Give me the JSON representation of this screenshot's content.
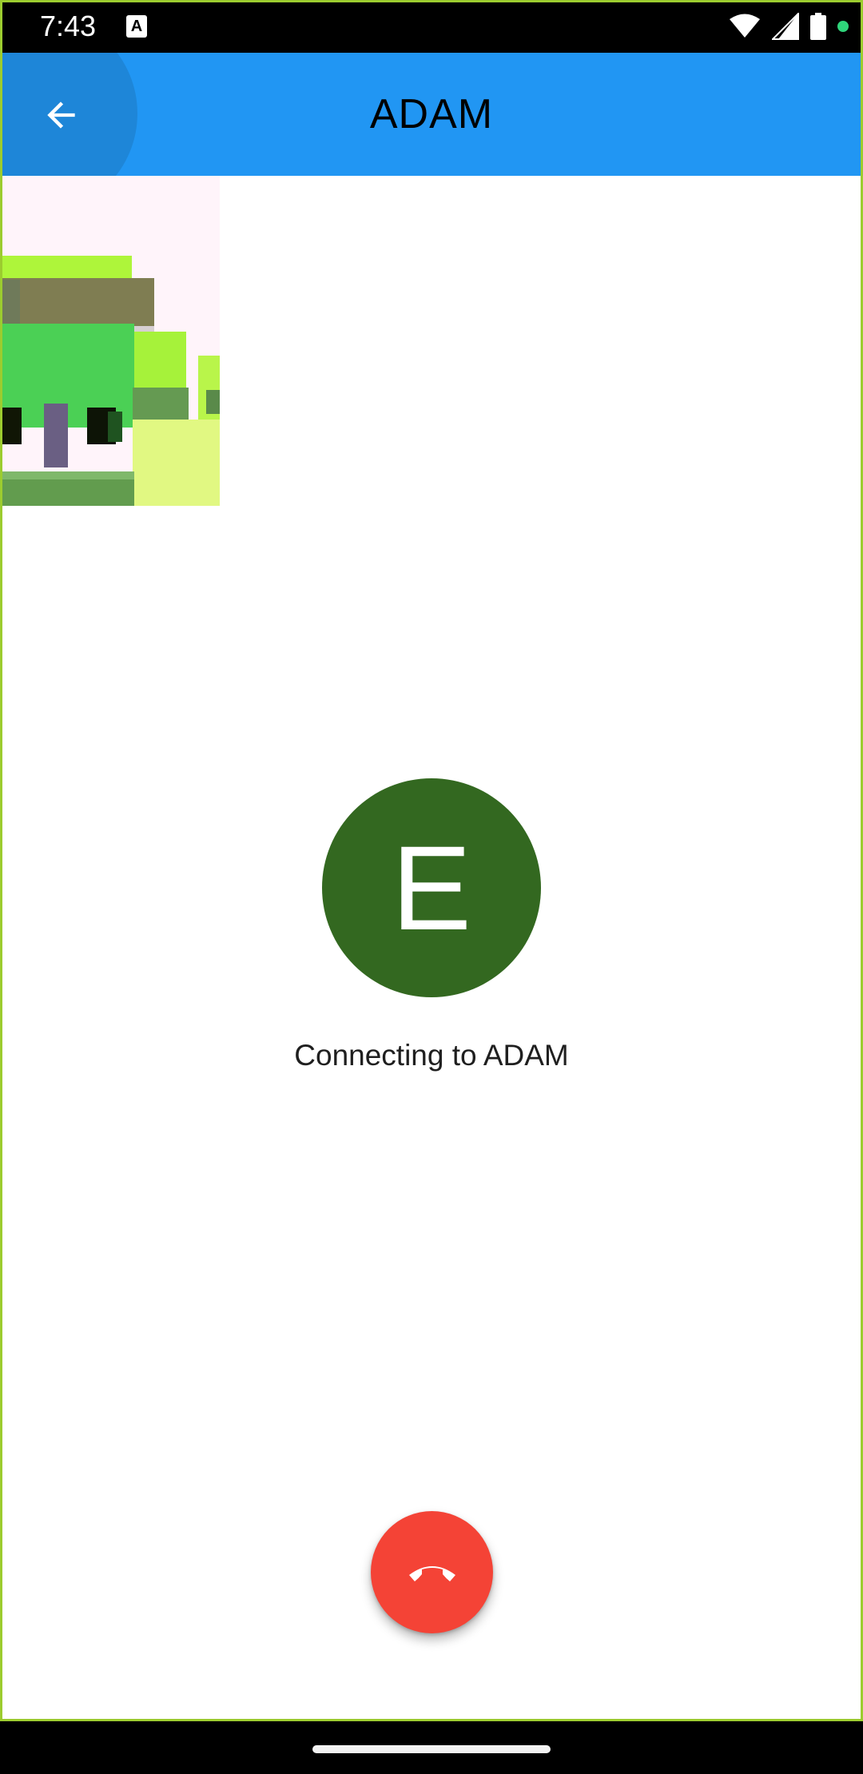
{
  "status_bar": {
    "time": "7:43",
    "notification_icon_letter": "A",
    "icons": [
      "wifi-icon",
      "signal-icon",
      "battery-icon",
      "privacy-dot-icon"
    ],
    "privacy_dot_color": "#2fd47a"
  },
  "app_bar": {
    "title": "ADAM",
    "back_icon": "arrow-back-icon",
    "color": "#2196f3"
  },
  "call": {
    "avatar_letter": "E",
    "avatar_color": "#336820",
    "status": "Connecting to ADAM",
    "hangup_icon": "call-end-icon",
    "hangup_color": "#f44336"
  },
  "local_preview": {
    "description_icon": "camera-preview"
  }
}
